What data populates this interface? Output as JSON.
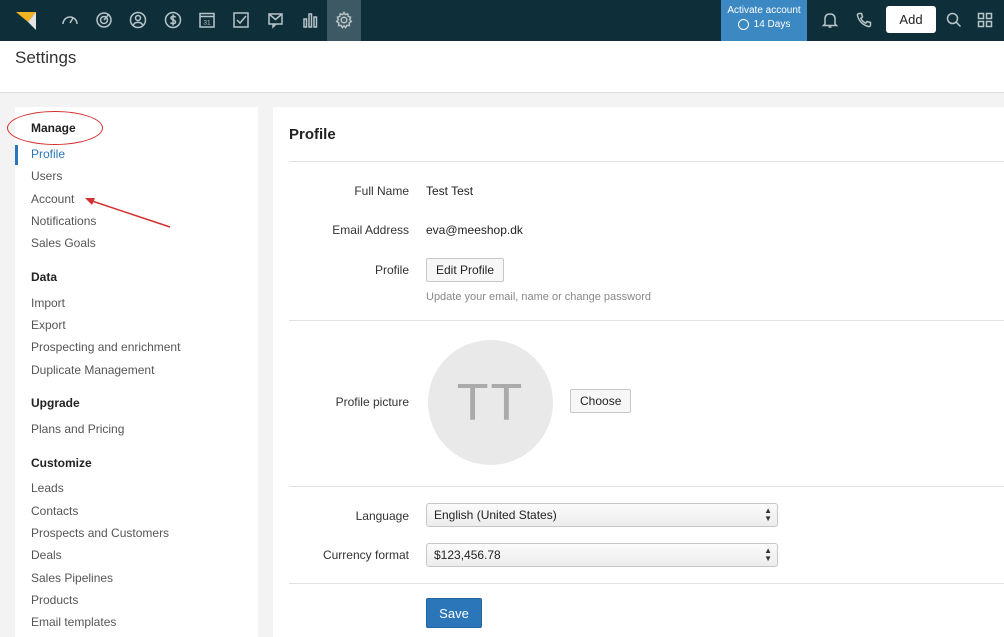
{
  "topbar": {
    "nav_icons": [
      "speedometer-icon",
      "target-icon",
      "contacts-icon",
      "dollar-icon",
      "calendar-icon",
      "checkbox-icon",
      "messages-icon",
      "bar-chart-icon",
      "gear-icon"
    ],
    "calendar_day": "31",
    "activate_label": "Activate account",
    "activate_days": "14 Days",
    "add_label": "Add",
    "colors": {
      "bar": "#0e2f3a",
      "accent": "#3c88c3",
      "active_tab": "#3d5964"
    }
  },
  "page": {
    "title": "Settings"
  },
  "sidebar": {
    "sections": [
      {
        "title": "Manage",
        "items": [
          "Profile",
          "Users",
          "Account",
          "Notifications",
          "Sales Goals"
        ]
      },
      {
        "title": "Data",
        "items": [
          "Import",
          "Export",
          "Prospecting and enrichment",
          "Duplicate Management"
        ]
      },
      {
        "title": "Upgrade",
        "items": [
          "Plans and Pricing"
        ]
      },
      {
        "title": "Customize",
        "items": [
          "Leads",
          "Contacts",
          "Prospects and Customers",
          "Deals",
          "Sales Pipelines",
          "Products",
          "Email templates"
        ]
      }
    ],
    "active_item": "Profile",
    "active_color": "#2b76b9"
  },
  "profile": {
    "title": "Profile",
    "full_name_label": "Full Name",
    "full_name": "Test Test",
    "email_label": "Email Address",
    "email": "eva@meeshop.dk",
    "profile_label": "Profile",
    "edit_profile_label": "Edit Profile",
    "edit_hint": "Update your email, name or change password",
    "picture_label": "Profile picture",
    "avatar_initials": "TT",
    "choose_label": "Choose",
    "language_label": "Language",
    "language_value": "English (United States)",
    "currency_label": "Currency format",
    "currency_value": "$123,456.78",
    "save_label": "Save"
  }
}
